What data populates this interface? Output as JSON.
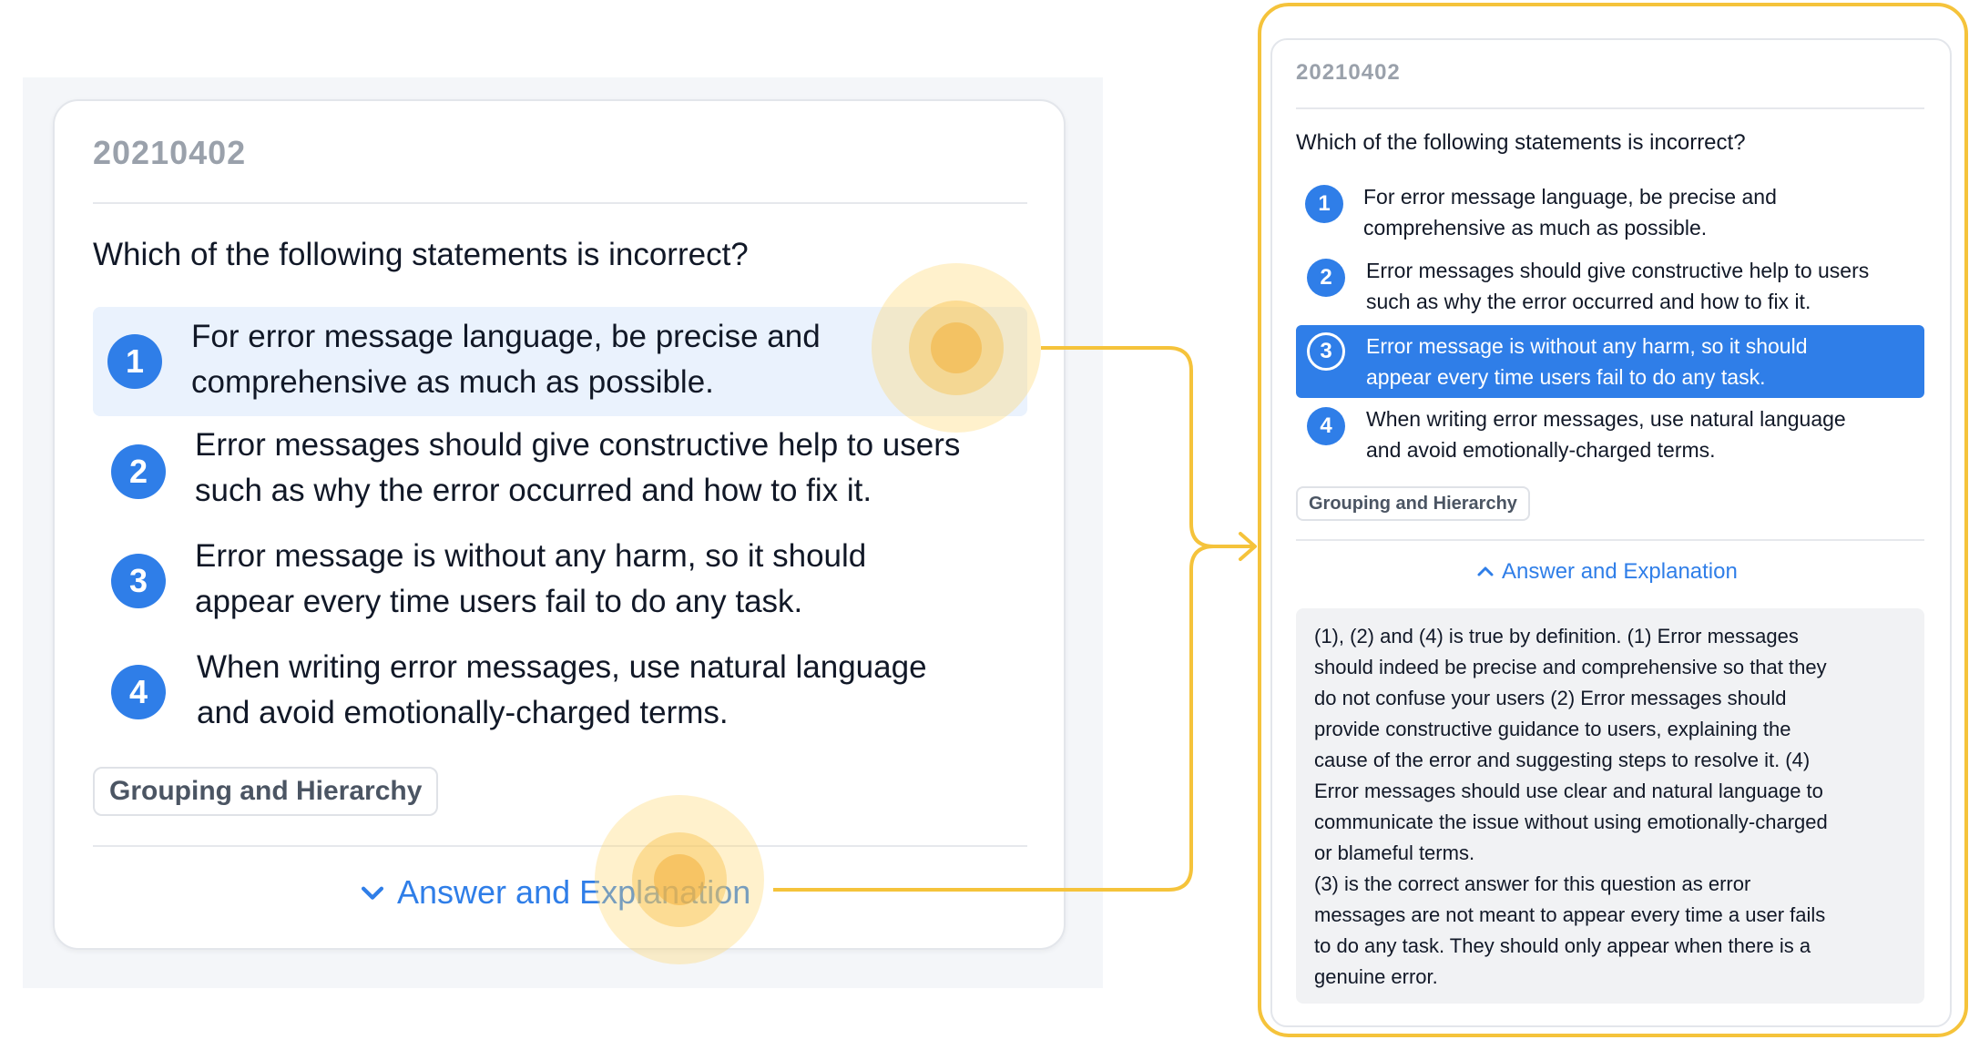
{
  "accent_color": "#2f7ee8",
  "highlight_color": "#f5c33b",
  "question_card": {
    "id": "20210402",
    "question": "Which of the following statements is incorrect?",
    "options": [
      {
        "number": "1",
        "lines": [
          "For error message language, be precise and",
          "comprehensive as much as possible."
        ]
      },
      {
        "number": "2",
        "lines": [
          "Error messages should give constructive help to users",
          "such as why the error occurred and how to fix it."
        ]
      },
      {
        "number": "3",
        "lines": [
          "Error message is without any harm, so it should",
          "appear every time users fail to do any task."
        ]
      },
      {
        "number": "4",
        "lines": [
          "When writing error messages, use natural language",
          "and avoid emotionally-charged terms."
        ]
      }
    ],
    "tag": "Grouping and Hierarchy",
    "toggle_label": "Answer and Explanation",
    "toggle_icon": "chevron-down-icon"
  },
  "answer_card": {
    "id": "20210402",
    "question": "Which of the following statements is incorrect?",
    "selected_option": "3",
    "options": [
      {
        "number": "1",
        "lines": [
          "For error message language, be precise and",
          "comprehensive as much as possible."
        ]
      },
      {
        "number": "2",
        "lines": [
          "Error messages should give constructive help to users",
          "such as why the error occurred and how to fix it."
        ]
      },
      {
        "number": "3",
        "lines": [
          "Error message is without any harm, so it should",
          "appear every time users fail to do any task."
        ]
      },
      {
        "number": "4",
        "lines": [
          "When writing error messages, use natural language",
          "and avoid emotionally-charged terms."
        ]
      }
    ],
    "tag": "Grouping and Hierarchy",
    "toggle_label": "Answer and Explanation",
    "toggle_icon": "chevron-up-icon",
    "explanation_lines": [
      "(1), (2) and (4) is true by definition. (1) Error messages",
      "should indeed be precise and comprehensive so that they",
      "do not confuse your users (2) Error messages should",
      "provide constructive guidance to users, explaining the",
      "cause of the error and suggesting steps to resolve it. (4)",
      "Error messages should use clear and natural language to",
      "communicate the issue without using emotionally-charged",
      "or blameful terms.",
      "(3) is the correct answer for this question as error",
      "messages are not meant to appear every time a user fails",
      "to do any task. They should only appear when there is a",
      "genuine error."
    ]
  }
}
